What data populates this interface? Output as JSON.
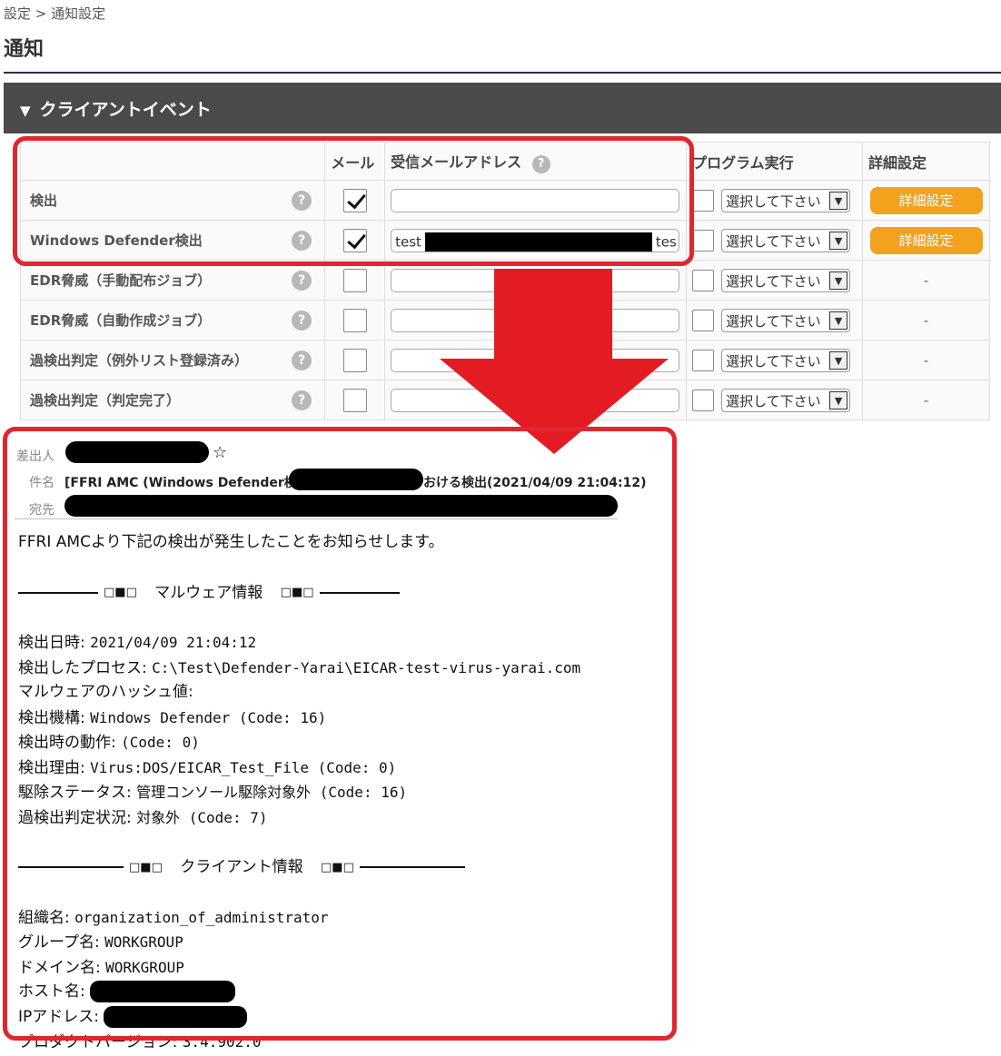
{
  "breadcrumb": "設定 > 通知設定",
  "page_title": "通知",
  "section": {
    "arrow": "▼",
    "title": "クライアントイベント"
  },
  "table": {
    "headers": {
      "event": "",
      "mail": "メール",
      "address": "受信メールアドレス",
      "program": "プログラム実行",
      "detail": "詳細設定"
    },
    "help_glyph": "?",
    "rows": [
      {
        "name": "検出",
        "mail_checked": true,
        "address_prefix": "",
        "address_suffix": "",
        "program_select": "選択して下さい",
        "detail": "詳細設定",
        "detail_is_button": true
      },
      {
        "name": "Windows Defender検出",
        "mail_checked": true,
        "address_prefix": "test",
        "address_suffix": "tes",
        "program_select": "選択して下さい",
        "detail": "詳細設定",
        "detail_is_button": true
      },
      {
        "name": "EDR脅威（手動配布ジョブ）",
        "mail_checked": false,
        "address_prefix": "",
        "address_suffix": "",
        "program_select": "選択して下さい",
        "detail": "-",
        "detail_is_button": false
      },
      {
        "name": "EDR脅威（自動作成ジョブ）",
        "mail_checked": false,
        "address_prefix": "",
        "address_suffix": "",
        "program_select": "選択して下さい",
        "detail": "-",
        "detail_is_button": false
      },
      {
        "name": "過検出判定（例外リスト登録済み）",
        "mail_checked": false,
        "address_prefix": "",
        "address_suffix": "",
        "program_select": "選択して下さい",
        "detail": "-",
        "detail_is_button": false
      },
      {
        "name": "過検出判定（判定完了）",
        "mail_checked": false,
        "address_prefix": "",
        "address_suffix": "",
        "program_select": "選択して下さい",
        "detail": "-",
        "detail_is_button": false
      }
    ]
  },
  "email": {
    "from_label": "差出人",
    "star": "☆",
    "subject_label": "件名",
    "subject_prefix": "[FFRI AMC (Windows Defender検出)]",
    "subject_suffix": "おける検出(2021/04/09 21:04:12)",
    "to_label": "宛先",
    "intro": "FFRI AMCより下記の検出が発生したことをお知らせします。",
    "sep_mark": "□■□",
    "malware_heading": "マルウェア情報",
    "malware": [
      {
        "label": "検出日時: ",
        "value": "2021/04/09 21:04:12"
      },
      {
        "label": "検出したプロセス: ",
        "value": "C:\\Test\\Defender-Yarai\\EICAR-test-virus-yarai.com"
      },
      {
        "label": "マルウェアのハッシュ値:",
        "value": ""
      },
      {
        "label": "検出機構: ",
        "value": "Windows Defender (Code: 16)"
      },
      {
        "label": "検出時の動作: ",
        "value": "  (Code: 0)"
      },
      {
        "label": "検出理由: ",
        "value": "Virus:DOS/EICAR_Test_File (Code: 0)"
      },
      {
        "label": "駆除ステータス: ",
        "value": "管理コンソール駆除対象外 (Code: 16)"
      },
      {
        "label": "過検出判定状況: ",
        "value": "対象外 (Code: 7)"
      }
    ],
    "client_heading": "クライアント情報",
    "client": [
      {
        "label": "組織名: ",
        "value": "organization_of_administrator"
      },
      {
        "label": "グループ名: ",
        "value": "WORKGROUP"
      },
      {
        "label": "ドメイン名: ",
        "value": "WORKGROUP"
      },
      {
        "label": "ホスト名: ",
        "value": ""
      },
      {
        "label": "IPアドレス: ",
        "value": ""
      },
      {
        "label": "プロダクトバージョン: ",
        "value": "3.4.902.0"
      }
    ]
  }
}
